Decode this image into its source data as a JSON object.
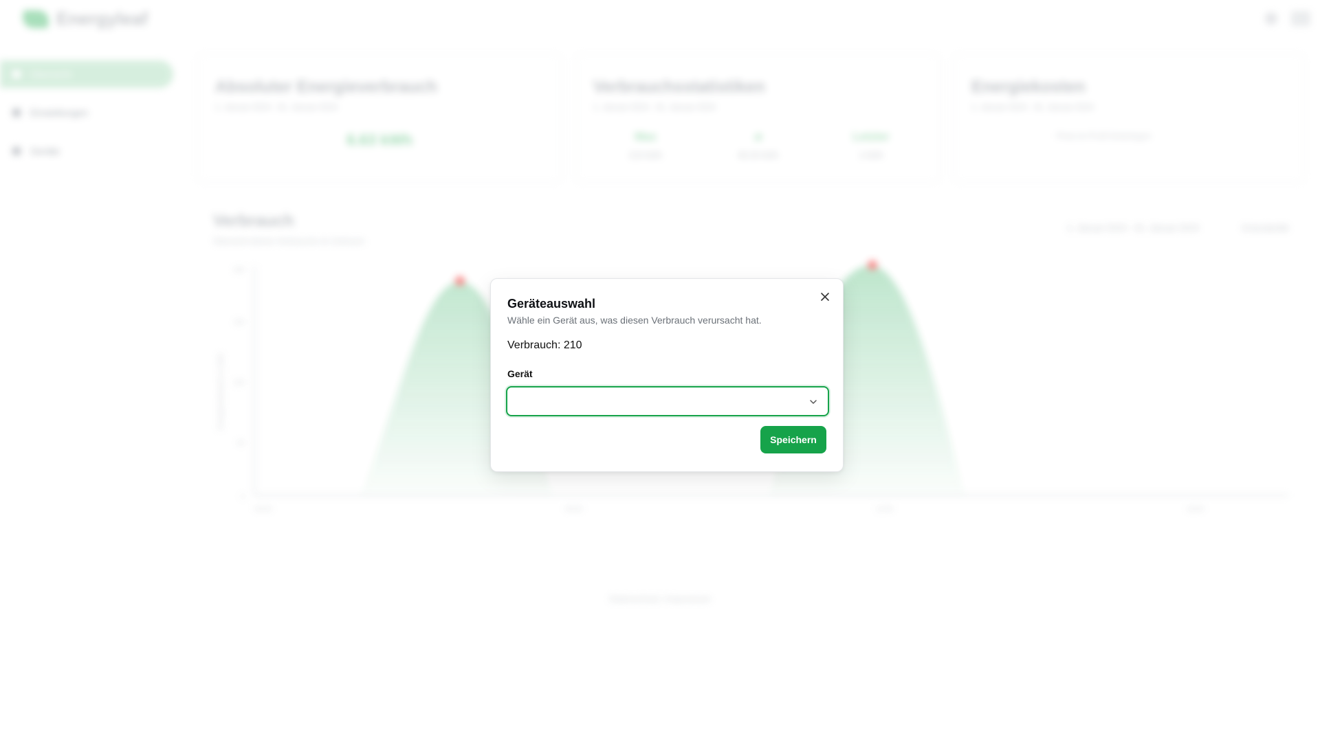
{
  "app": {
    "brand": "Energyleaf",
    "sidebar": {
      "items": [
        {
          "label": "Übersicht",
          "icon": "dashboard-icon"
        },
        {
          "label": "Einstellungen",
          "icon": "gear-icon"
        },
        {
          "label": "Geräte",
          "icon": "devices-icon"
        }
      ]
    },
    "cards": {
      "absolute": {
        "title": "Absoluter Energieverbrauch",
        "subtitle": "1. Januar 2024 - 31. Januar 2024",
        "value": "6.63 kWh"
      },
      "stats": {
        "title": "Verbrauchsstatistiken",
        "subtitle": "1. Januar 2024 - 31. Januar 2024",
        "items": [
          {
            "label": "Max",
            "value": "210 kWh"
          },
          {
            "label": "ø",
            "value": "66.30 kWh"
          },
          {
            "label": "Letzter",
            "value": "1 kWh"
          }
        ]
      },
      "costs": {
        "title": "Energiekosten",
        "subtitle": "1. Januar 2024 - 31. Januar 2024",
        "select": "Preis im Profil hinterlegen"
      }
    },
    "chart": {
      "title": "Verbrauch",
      "subtitle": "Übersicht deines Verbrauchs im Zeitraum",
      "date_range": "1. Januar 2024 - 31. Januar 2024",
      "granularity": "Granularität",
      "ylabel": "Energieverbrauch in kWh",
      "x_ticks": [
        "00:00",
        "06:00",
        "12:00",
        "18:00"
      ],
      "y_ticks": [
        "0",
        "50",
        "100",
        "150",
        "200"
      ]
    },
    "footer": {
      "links": [
        "Datenschutz",
        "Impressum"
      ]
    },
    "colors": {
      "accent": "#16a34a",
      "peak": "#f87171"
    }
  },
  "modal": {
    "title": "Geräteauswahl",
    "description": "Wähle ein Gerät aus, was diesen Verbrauch verursacht hat.",
    "usage_text": "Verbrauch: 210",
    "field_label": "Gerät",
    "select_value": "",
    "save_label": "Speichern"
  }
}
